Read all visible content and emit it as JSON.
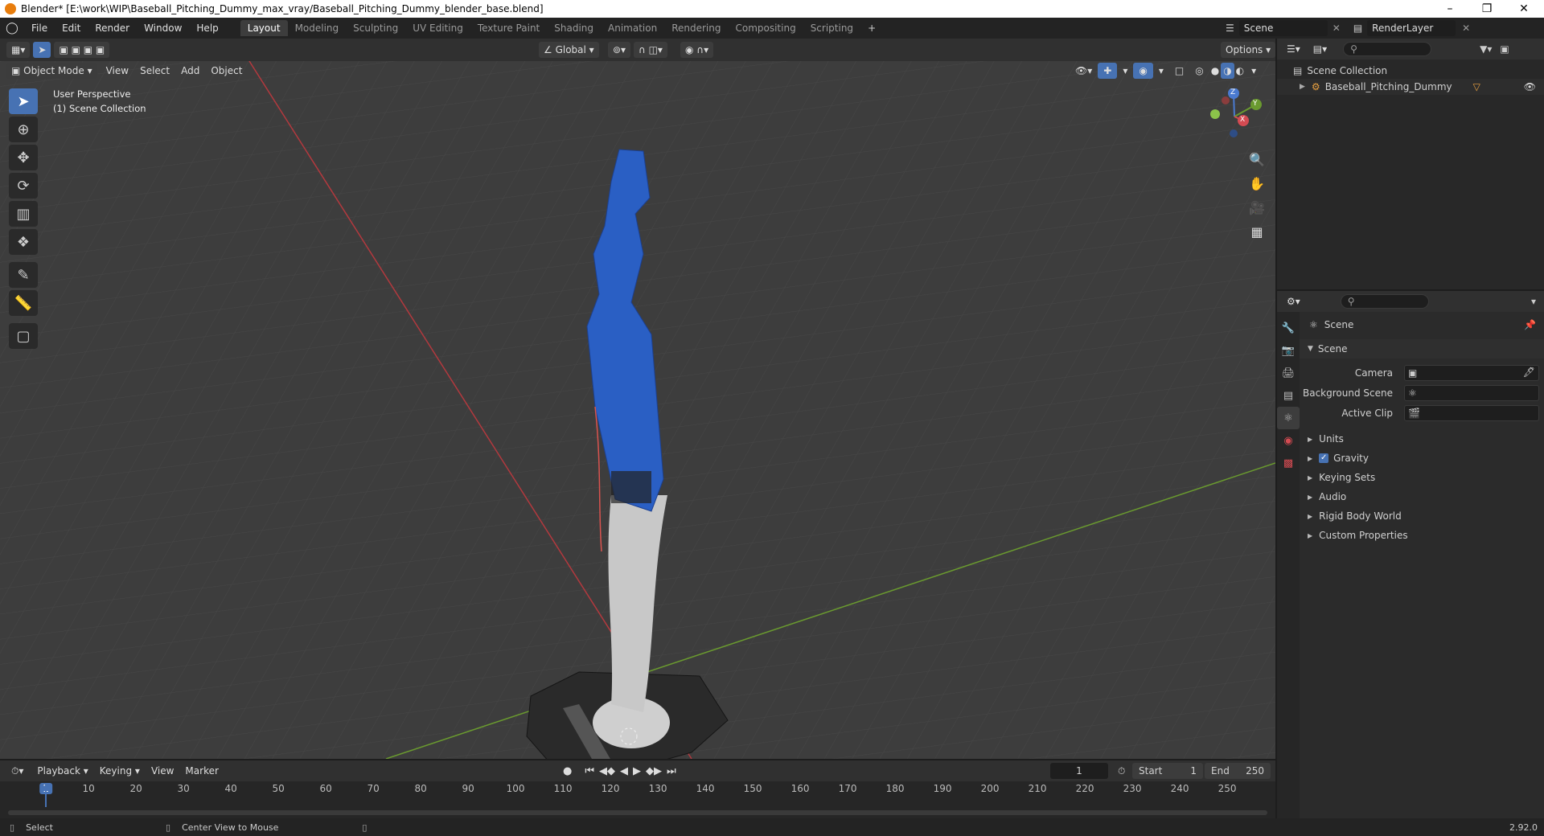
{
  "window": {
    "title": "Blender* [E:\\work\\WIP\\Baseball_Pitching_Dummy_max_vray/Baseball_Pitching_Dummy_blender_base.blend]"
  },
  "menu": [
    "File",
    "Edit",
    "Render",
    "Window",
    "Help"
  ],
  "workspaces": [
    "Layout",
    "Modeling",
    "Sculpting",
    "UV Editing",
    "Texture Paint",
    "Shading",
    "Animation",
    "Rendering",
    "Compositing",
    "Scripting"
  ],
  "active_workspace": "Layout",
  "top_right": {
    "scene": "Scene",
    "render_layer": "RenderLayer"
  },
  "viewport_header": {
    "transform_orientation": "Global",
    "options": "Options"
  },
  "viewport_menu": {
    "mode": "Object Mode",
    "items": [
      "View",
      "Select",
      "Add",
      "Object"
    ]
  },
  "viewport_overlay": {
    "perspective": "User Perspective",
    "collection": "(1) Scene Collection"
  },
  "gizmo": {
    "x": "X",
    "y": "Y",
    "z": "Z"
  },
  "outliner": {
    "root": "Scene Collection",
    "items": [
      "Baseball_Pitching_Dummy"
    ]
  },
  "properties": {
    "context": "Scene",
    "panel": "Scene",
    "fields": [
      {
        "label": "Camera"
      },
      {
        "label": "Background Scene"
      },
      {
        "label": "Active Clip"
      }
    ],
    "sections": [
      "Units",
      "Gravity",
      "Keying Sets",
      "Audio",
      "Rigid Body World",
      "Custom Properties"
    ],
    "gravity_checked": true
  },
  "timeline": {
    "menus": [
      "Playback",
      "Keying",
      "View",
      "Marker"
    ],
    "current_frame": "1",
    "start_label": "Start",
    "start": "1",
    "end_label": "End",
    "end": "250",
    "ticks": [
      "1",
      "10",
      "20",
      "30",
      "40",
      "50",
      "60",
      "70",
      "80",
      "90",
      "100",
      "110",
      "120",
      "130",
      "140",
      "150",
      "160",
      "170",
      "180",
      "190",
      "200",
      "210",
      "220",
      "230",
      "240",
      "250"
    ]
  },
  "status": {
    "left": "Select",
    "middle": "Center View to Mouse",
    "version": "2.92.0"
  }
}
